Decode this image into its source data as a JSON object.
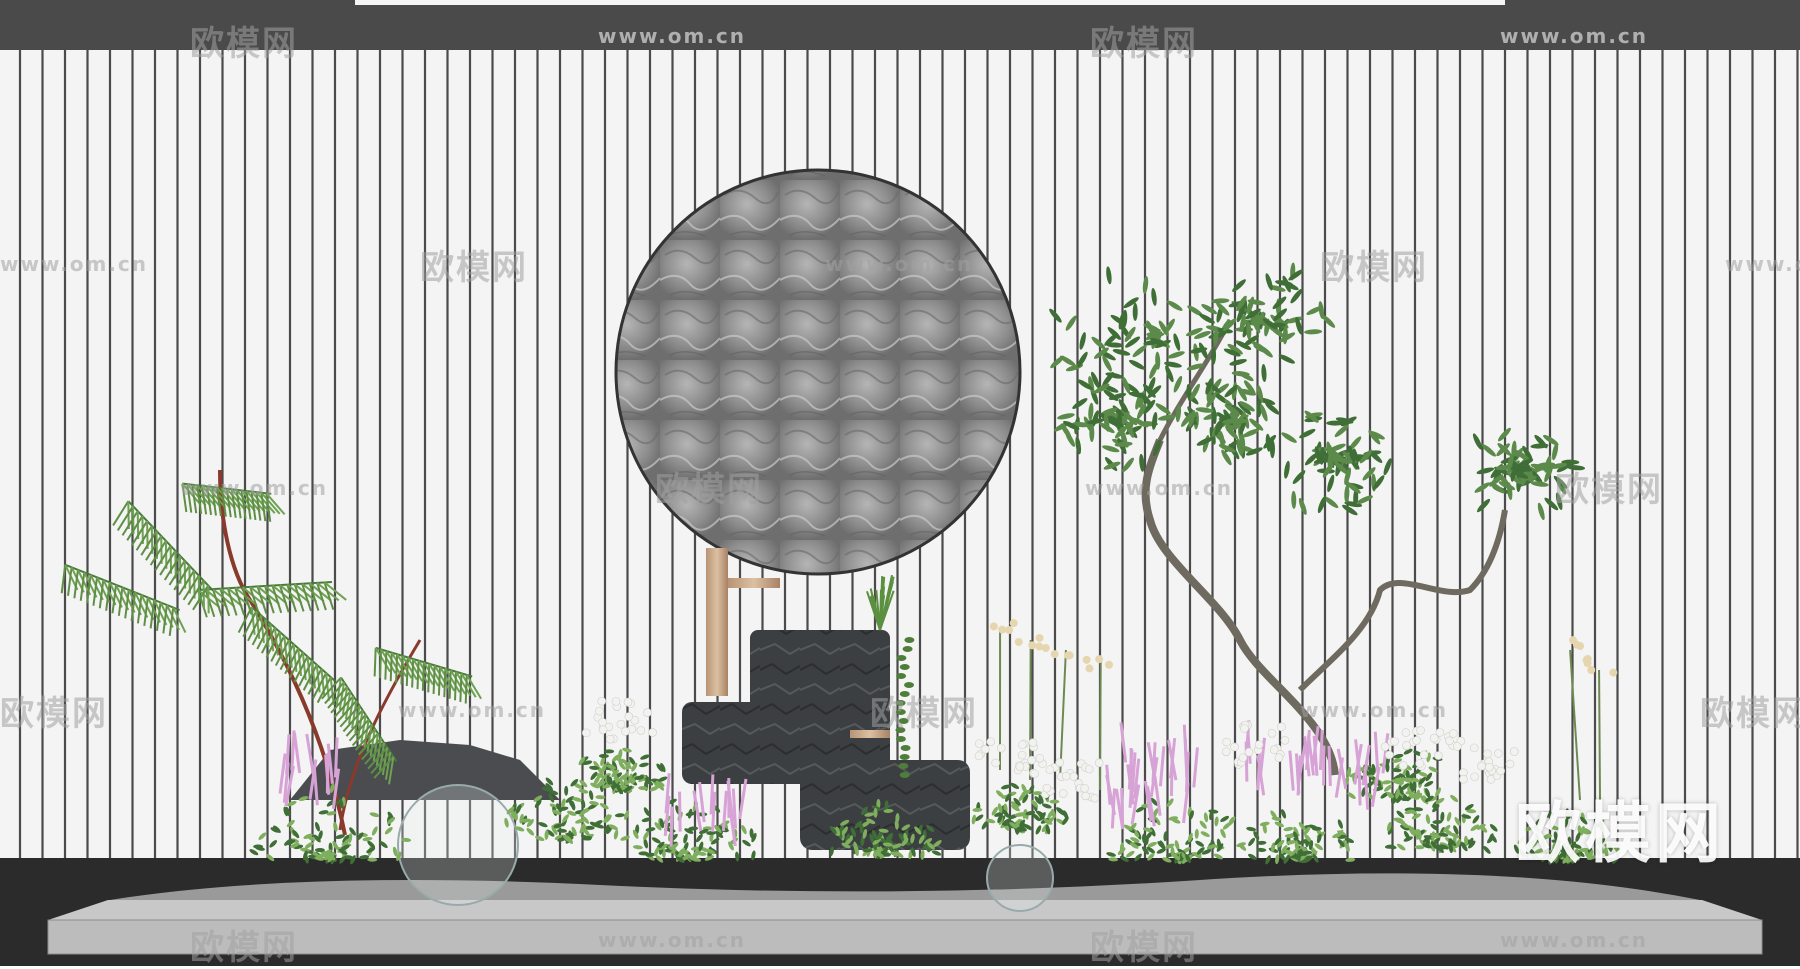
{
  "scene": {
    "description_elements": [
      "slatted-wall",
      "stone-moon-disc",
      "bamboo-spout",
      "stone-water-basin",
      "fern-plant",
      "tree",
      "shrubs",
      "flowers",
      "pebble-planter"
    ],
    "colors": {
      "top_band": "#4a4a4a",
      "wall": "#f4f4f4",
      "slat_line": "#4b4b4b",
      "floor": "#2b2b2b",
      "planter": "#bdbdbd",
      "stone_disc": "#8f8f8f",
      "basin": "#3a3d3f",
      "bamboo": "#c9a98a",
      "leaf_dark": "#3f6e36",
      "leaf_light": "#7fae5e",
      "pink_flower": "#d7a2d6",
      "white_flower": "#f2f2ee"
    }
  },
  "watermarks": {
    "logo_text": "欧模网",
    "url_text": "www.om.cn",
    "big_logo_text": "欧模网"
  }
}
